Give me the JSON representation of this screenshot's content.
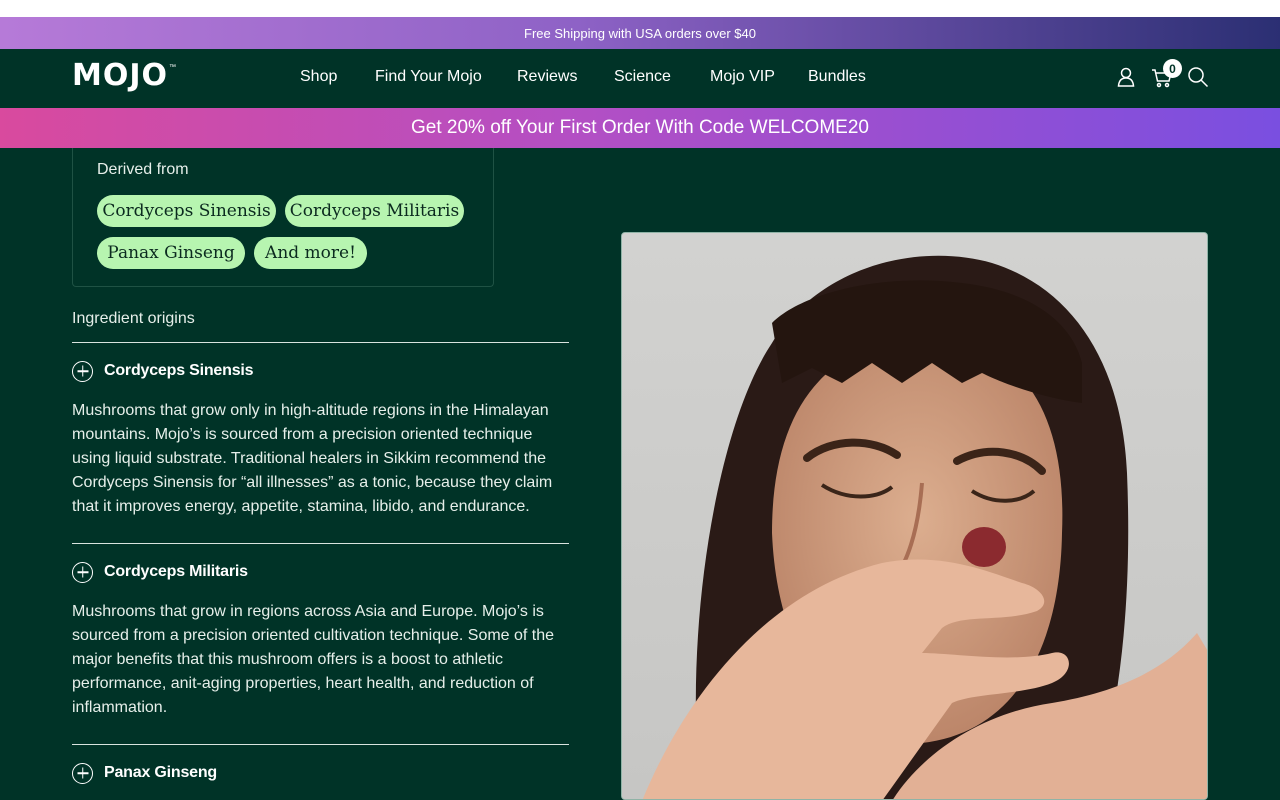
{
  "shipping_banner": "Free Shipping with USA orders over $40",
  "header": {
    "logo": "MOJO",
    "logo_tm": "™",
    "nav": [
      "Shop",
      "Find Your Mojo",
      "Reviews",
      "Science",
      "Mojo VIP",
      "Bundles"
    ],
    "cart_count": "0",
    "icons": [
      "user-icon",
      "cart-icon",
      "search-icon"
    ]
  },
  "promo_banner": "Get 20% off Your First Order With Code WELCOME20",
  "derived": {
    "label": "Derived from",
    "pills": [
      "Cordyceps Sinensis",
      "Cordyceps Militaris",
      "Panax Ginseng",
      "And more!"
    ]
  },
  "origins": {
    "label": "Ingredient origins",
    "items": [
      {
        "title": "Cordyceps Sinensis",
        "body": "Mushrooms that grow only in high-altitude regions in the Himalayan mountains. Mojo’s is sourced from a precision oriented technique using liquid substrate. Traditional healers in Sikkim recommend the Cordyceps Sinensis for “all illnesses” as a tonic, because they claim that it improves energy, appetite, stamina, libido, and endurance."
      },
      {
        "title": "Cordyceps Militaris",
        "body": "Mushrooms that grow in regions across Asia and Europe. Mojo’s is sourced from a precision oriented cultivation technique. Some of the major benefits that this mushroom offers is a boost to athletic performance, anit-aging properties, heart health, and reduction of inflammation."
      },
      {
        "title": "Panax Ginseng",
        "body": ""
      }
    ]
  },
  "colors": {
    "background": "#003327",
    "pill": "#b7f5b0",
    "promo_start": "#d94a9e",
    "promo_end": "#7a4fe0"
  }
}
